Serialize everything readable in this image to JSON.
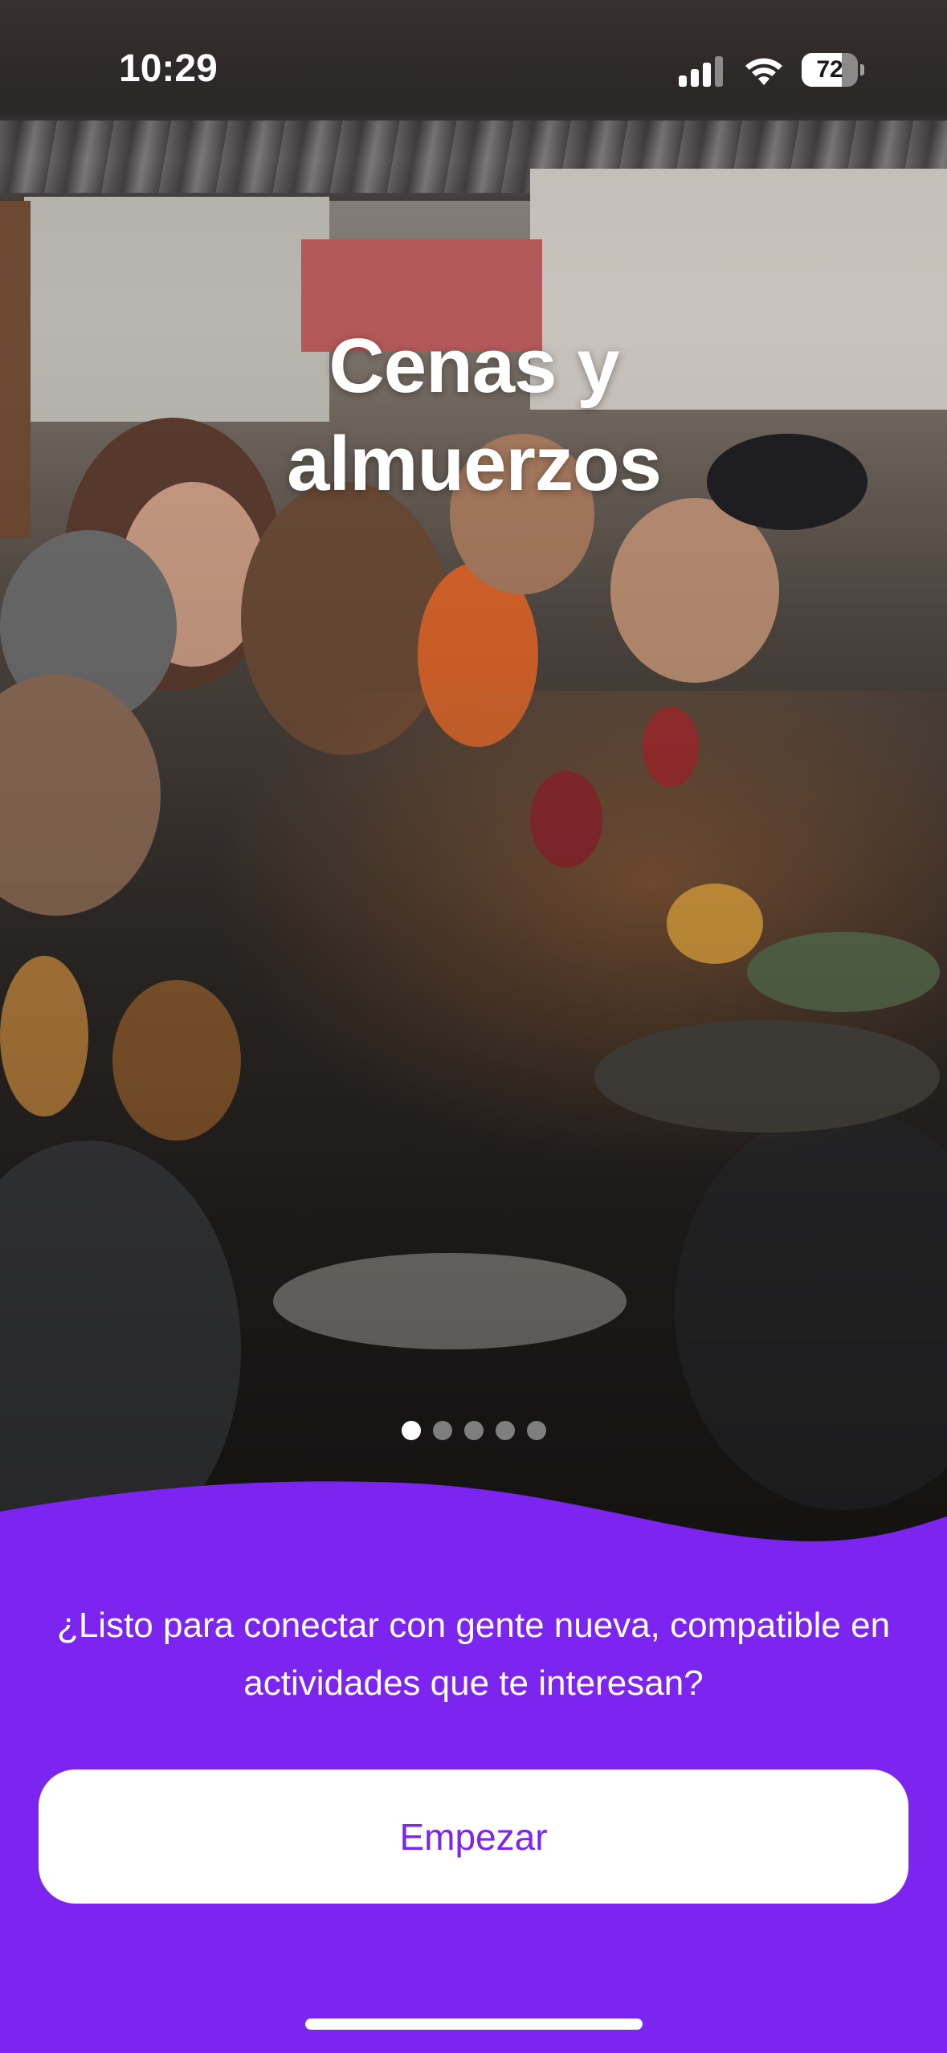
{
  "status_bar": {
    "time": "10:29",
    "battery_level": "72",
    "battery_fraction": 0.72,
    "icons": [
      "signal-icon",
      "wifi-icon",
      "battery-icon"
    ]
  },
  "hero": {
    "image": "group-dining-photo",
    "title": "Cenas y almuerzos"
  },
  "pager": {
    "total": 5,
    "active_index": 0
  },
  "panel": {
    "tagline": "¿Listo para conectar con gente nueva, compatible en actividades que te interesan?",
    "start_label": "Empezar"
  },
  "colors": {
    "accent": "#7c25f0",
    "button_bg": "#ffffff",
    "text_light": "#ffffff"
  }
}
